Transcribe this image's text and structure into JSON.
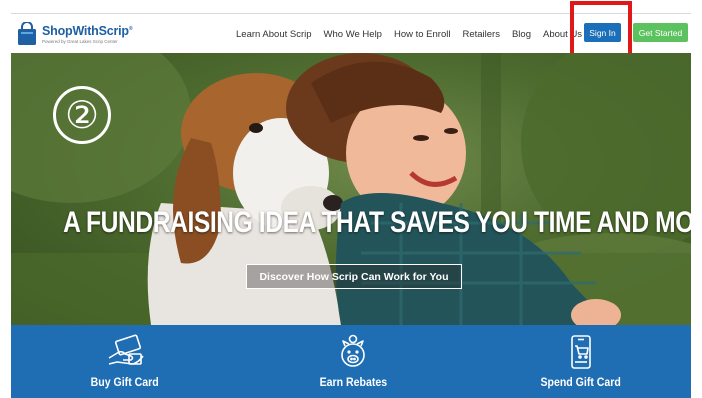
{
  "header": {
    "logo": {
      "name_part1": "ShopWith",
      "name_part2": "Scrip",
      "reg": "®",
      "tagline": "Powered by Great Lakes Scrip Center"
    },
    "nav": [
      {
        "label": "Learn About Scrip"
      },
      {
        "label": "Who We Help"
      },
      {
        "label": "How to Enroll"
      },
      {
        "label": "Retailers"
      },
      {
        "label": "Blog"
      },
      {
        "label": "About Us"
      }
    ],
    "sign_in_label": "Sign In",
    "get_started_label": "Get Started"
  },
  "hero": {
    "step_marker": "②",
    "title": "A FUNDRAISING IDEA THAT SAVES YOU TIME AND MONEY",
    "cta_label": "Discover How Scrip Can Work for You"
  },
  "features": [
    {
      "label": "Buy Gift Card",
      "icon": "gift-card-hand-icon"
    },
    {
      "label": "Earn Rebates",
      "icon": "piggy-bank-icon"
    },
    {
      "label": "Spend Gift Card",
      "icon": "mobile-cart-icon"
    }
  ],
  "colors": {
    "brand_blue": "#1f6db3",
    "sign_in_blue": "#1b6fb8",
    "get_started_green": "#5cc25f",
    "highlight_red": "#e01818"
  }
}
